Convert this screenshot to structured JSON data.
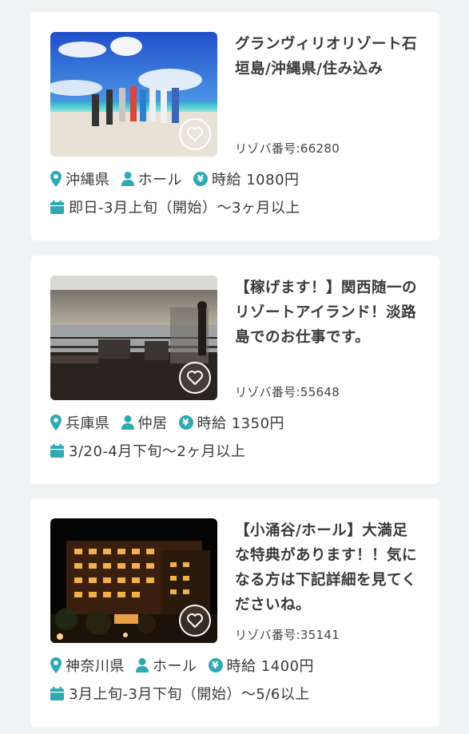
{
  "accent_color": "#2fa9b3",
  "listings": [
    {
      "title": "グランヴィリオリゾート石垣島/沖縄県/住み込み",
      "number": "リゾバ番号:66280",
      "location": "沖縄県",
      "job": "ホール",
      "wage": "時給 1080円",
      "period": "即日-3月上旬（開始）〜3ヶ月以上",
      "image": "beach-group-photo"
    },
    {
      "title": "【稼げます！】関西随一のリゾートアイランド！淡路島でのお仕事です。",
      "number": "リゾバ番号:55648",
      "location": "兵庫県",
      "job": "仲居",
      "wage": "時給 1350円",
      "period": "3/20-4月下旬〜2ヶ月以上",
      "image": "seaside-terrace-photo"
    },
    {
      "title": "【小涌谷/ホール】大満足な特典があります！！気になる方は下記詳細を見てくださいね。",
      "number": "リゾバ番号:35141",
      "location": "神奈川県",
      "job": "ホール",
      "wage": "時給 1400円",
      "period": "3月上旬-3月下旬（開始）〜5/6以上",
      "image": "hotel-night-photo"
    }
  ]
}
